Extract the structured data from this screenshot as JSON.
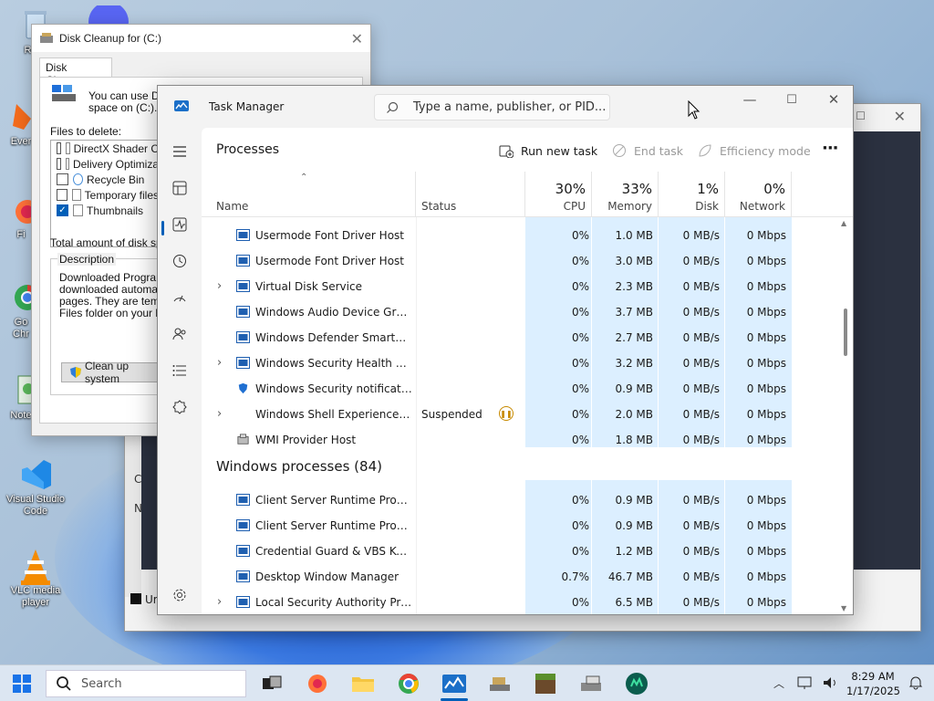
{
  "desktop": {
    "icons": [
      {
        "name": "recycle-bin-icon",
        "label": "Recy"
      },
      {
        "name": "ever-icon",
        "label": "Ever"
      },
      {
        "name": "firefox-desktop-icon",
        "label": "Fi"
      },
      {
        "name": "chrome-desktop-icon",
        "label": "Go\nChr"
      },
      {
        "name": "notepad-desktop-icon",
        "label": "Note"
      },
      {
        "name": "vscode-desktop-icon",
        "label": "Visual Studio Code"
      },
      {
        "name": "vlc-desktop-icon",
        "label": "VLC media player"
      }
    ]
  },
  "disk_cleanup": {
    "title": "Disk Cleanup for  (C:)",
    "tab": "Disk Cleanup",
    "intro_line1": "You can use Dis",
    "intro_line2": "space on  (C:).",
    "files_label": "Files to delete:",
    "files": [
      {
        "label": "DirectX Shader C",
        "checked": false
      },
      {
        "label": "Delivery Optimiza",
        "checked": false
      },
      {
        "label": "Recycle Bin",
        "checked": false
      },
      {
        "label": "Temporary files",
        "checked": false
      },
      {
        "label": "Thumbnails",
        "checked": true
      }
    ],
    "total_label": "Total amount of disk spac",
    "description_label": "Description",
    "description_lines": [
      "Downloaded Program F",
      "downloaded automatica",
      "pages. They are tempo",
      "Files folder on your hard"
    ],
    "cleanup_button": "Clean up system"
  },
  "background_window": {
    "fragment_c": "C",
    "fragment_n": "N",
    "fragment_un": "Ur"
  },
  "task_manager": {
    "app_title": "Task Manager",
    "search_placeholder": "Type a name, publisher, or PID...",
    "heading": "Processes",
    "run_new_task": "Run new task",
    "end_task": "End task",
    "efficiency_mode": "Efficiency mode",
    "more": "···",
    "columns": {
      "name": "Name",
      "status": "Status",
      "cpu_pct": "30%",
      "cpu": "CPU",
      "mem_pct": "33%",
      "memory": "Memory",
      "disk_pct": "1%",
      "disk": "Disk",
      "net_pct": "0%",
      "network": "Network"
    },
    "rows": [
      {
        "name": "Usermode Font Driver Host",
        "status": "",
        "cpu": "0%",
        "memory": "1.0 MB",
        "disk": "0 MB/s",
        "network": "0 Mbps",
        "expand": false
      },
      {
        "name": "Usermode Font Driver Host",
        "status": "",
        "cpu": "0%",
        "memory": "3.0 MB",
        "disk": "0 MB/s",
        "network": "0 Mbps",
        "expand": false
      },
      {
        "name": "Virtual Disk Service",
        "status": "",
        "cpu": "0%",
        "memory": "2.3 MB",
        "disk": "0 MB/s",
        "network": "0 Mbps",
        "expand": true
      },
      {
        "name": "Windows Audio Device Graph ...",
        "status": "",
        "cpu": "0%",
        "memory": "3.7 MB",
        "disk": "0 MB/s",
        "network": "0 Mbps",
        "expand": false
      },
      {
        "name": "Windows Defender SmartScreen",
        "status": "",
        "cpu": "0%",
        "memory": "2.7 MB",
        "disk": "0 MB/s",
        "network": "0 Mbps",
        "expand": false
      },
      {
        "name": "Windows Security Health Servi...",
        "status": "",
        "cpu": "0%",
        "memory": "3.2 MB",
        "disk": "0 MB/s",
        "network": "0 Mbps",
        "expand": true
      },
      {
        "name": "Windows Security notification...",
        "status": "",
        "cpu": "0%",
        "memory": "0.9 MB",
        "disk": "0 MB/s",
        "network": "0 Mbps",
        "expand": false
      },
      {
        "name": "Windows Shell Experience Hos...",
        "status": "Suspended",
        "cpu": "0%",
        "memory": "2.0 MB",
        "disk": "0 MB/s",
        "network": "0 Mbps",
        "expand": true
      },
      {
        "name": "WMI Provider Host",
        "status": "",
        "cpu": "0%",
        "memory": "1.8 MB",
        "disk": "0 MB/s",
        "network": "0 Mbps",
        "expand": false
      }
    ],
    "section_windows": "Windows processes (84)",
    "windows_rows": [
      {
        "name": "Client Server Runtime Process",
        "cpu": "0%",
        "memory": "0.9 MB",
        "disk": "0 MB/s",
        "network": "0 Mbps",
        "expand": false
      },
      {
        "name": "Client Server Runtime Process",
        "cpu": "0%",
        "memory": "0.9 MB",
        "disk": "0 MB/s",
        "network": "0 Mbps",
        "expand": false
      },
      {
        "name": "Credential Guard & VBS Key Is...",
        "cpu": "0%",
        "memory": "1.2 MB",
        "disk": "0 MB/s",
        "network": "0 Mbps",
        "expand": false
      },
      {
        "name": "Desktop Window Manager",
        "cpu": "0.7%",
        "memory": "46.7 MB",
        "disk": "0 MB/s",
        "network": "0 Mbps",
        "expand": false
      },
      {
        "name": "Local Security Authority Proce...",
        "cpu": "0%",
        "memory": "6.5 MB",
        "disk": "0 MB/s",
        "network": "0 Mbps",
        "expand": true
      }
    ]
  },
  "taskbar": {
    "search_placeholder": "Search",
    "time": "8:29 AM",
    "date": "1/17/2025"
  }
}
